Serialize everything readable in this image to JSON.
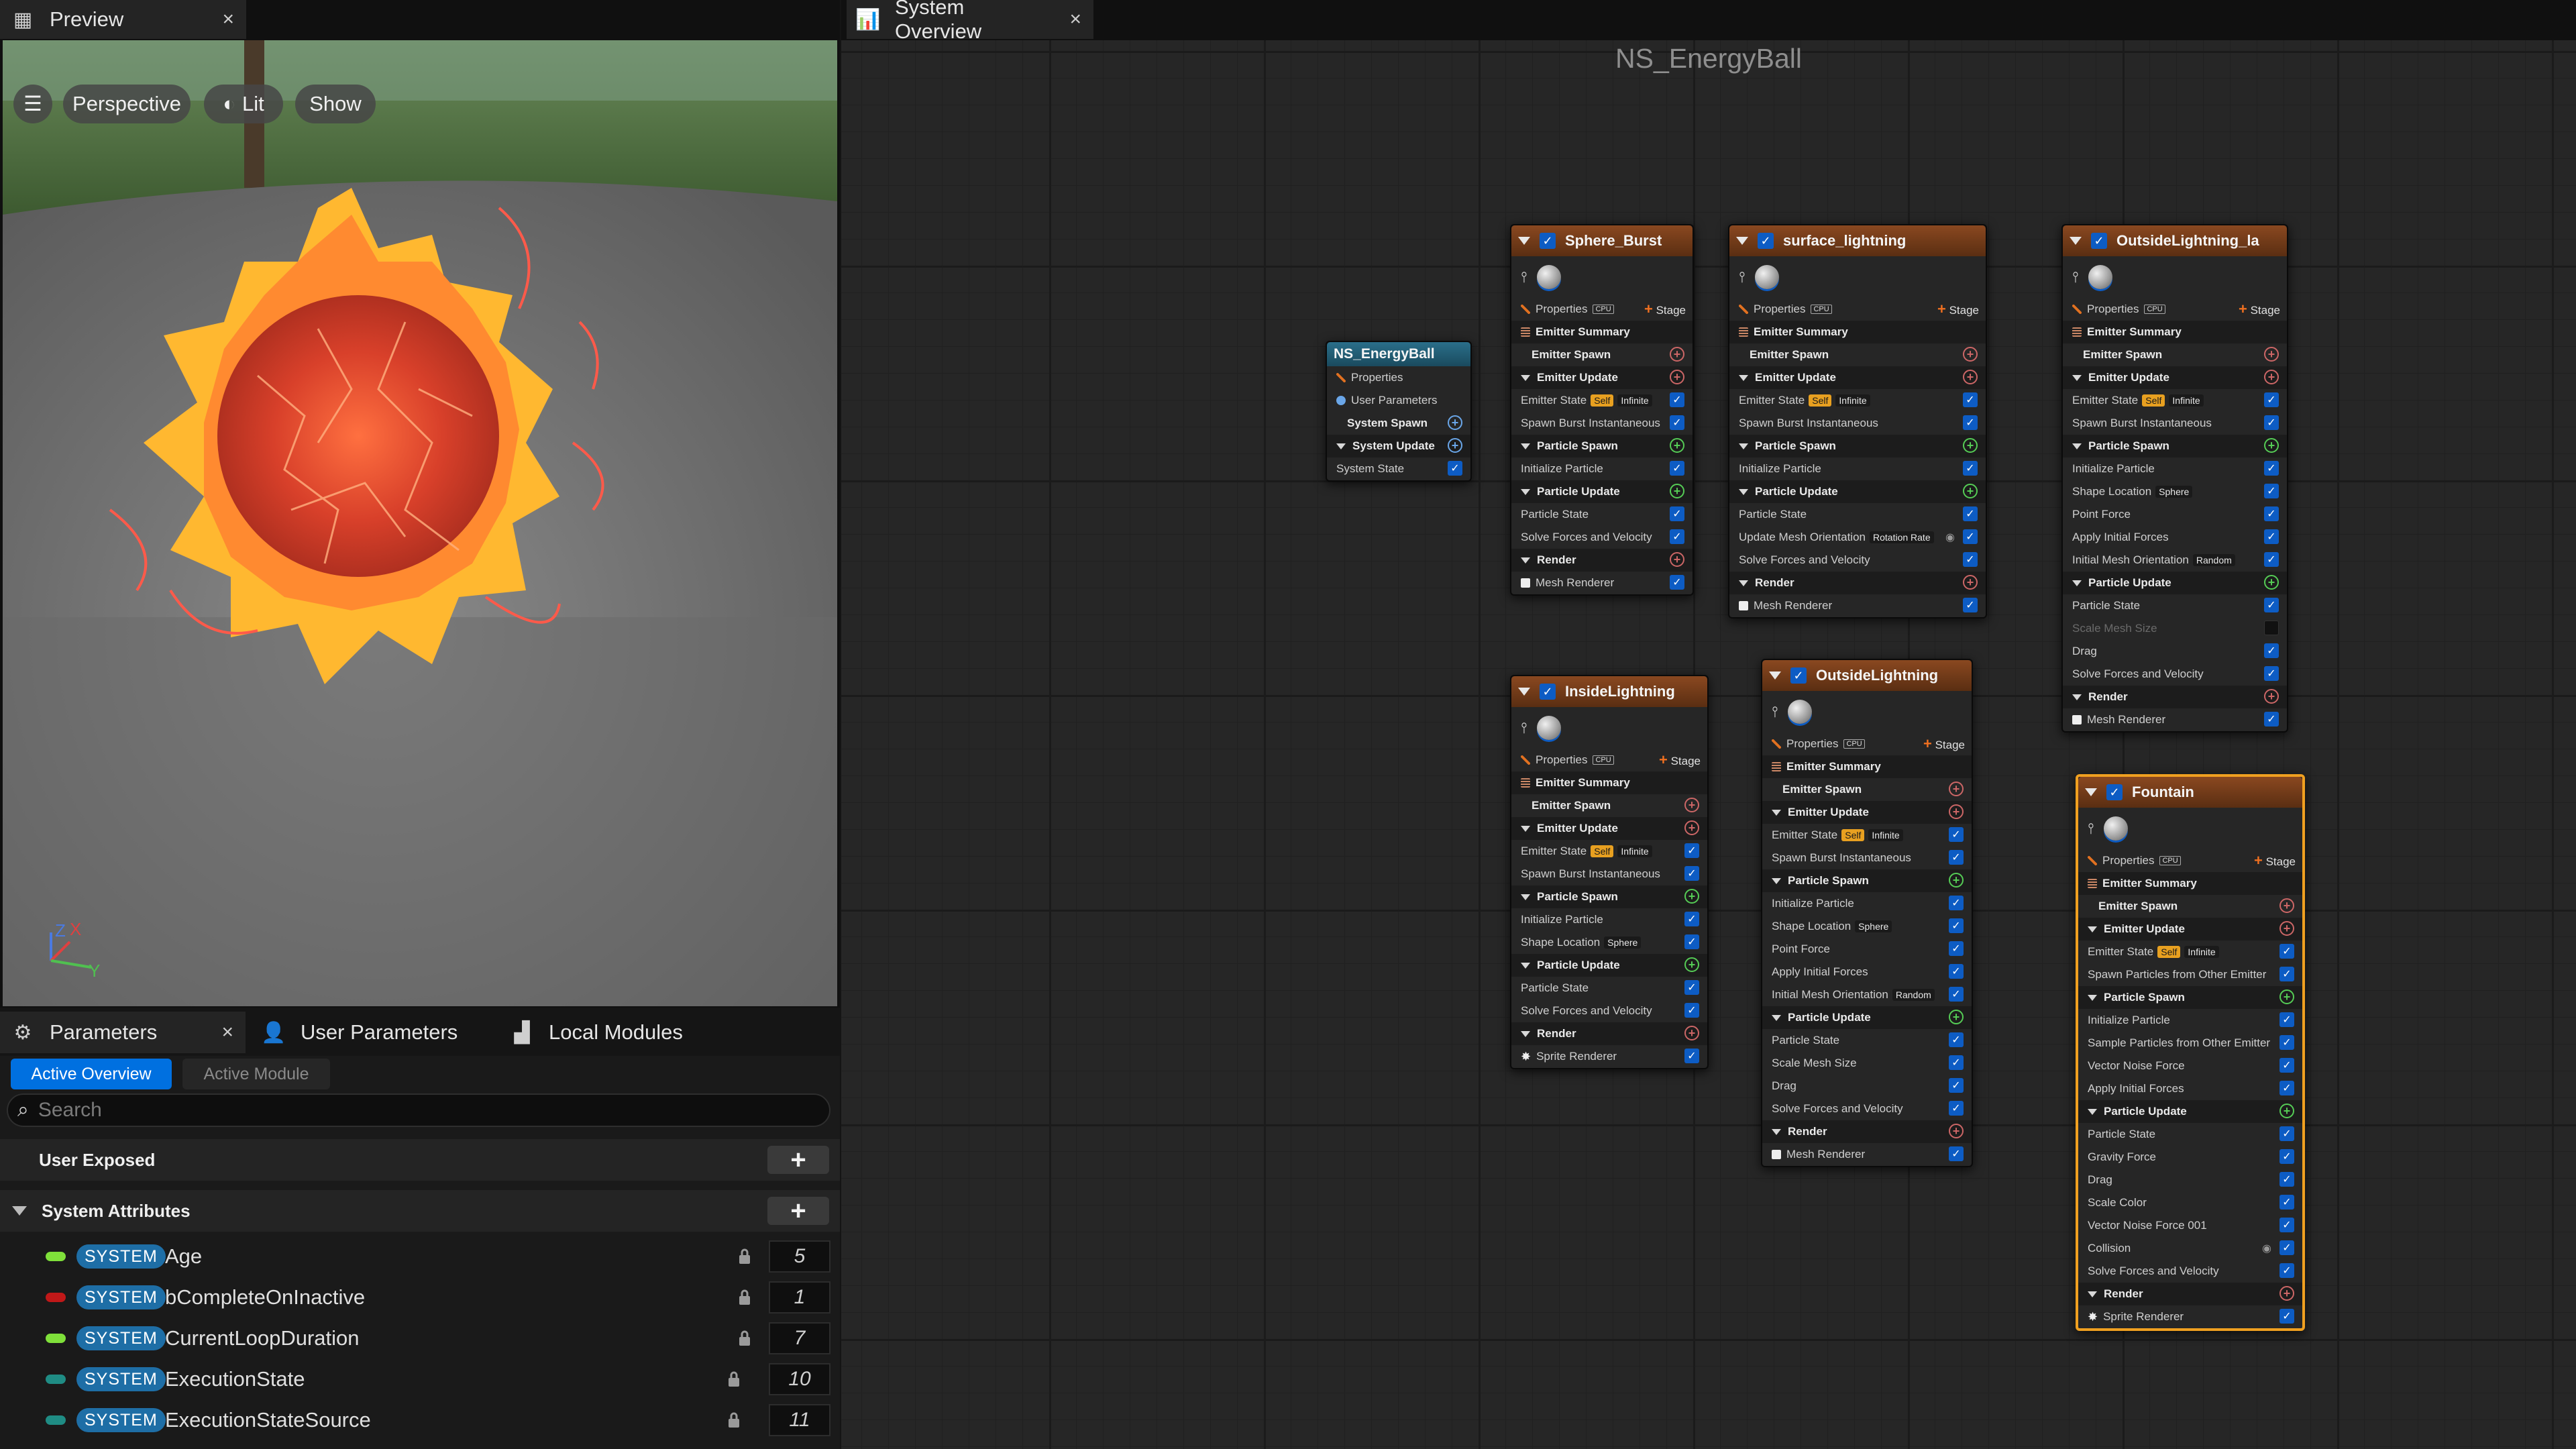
{
  "preview_tab": {
    "title": "Preview",
    "close": "×"
  },
  "viewport": {
    "perspective": "Perspective",
    "lit": "Lit",
    "show": "Show",
    "axis_z": "Z",
    "axis_x": "X",
    "axis_y": "Y"
  },
  "params_tabs": {
    "parameters": "Parameters",
    "close": "×",
    "user_parameters": "User Parameters",
    "local_modules": "Local Modules"
  },
  "params": {
    "active_overview": "Active Overview",
    "active_module": "Active Module",
    "search_placeholder": "Search",
    "user_exposed": "User Exposed",
    "system_attributes": "System Attributes",
    "add": "+",
    "attributes": [
      {
        "badge": "SYSTEM",
        "name": "Age",
        "value": "5",
        "color": "#7fe03a"
      },
      {
        "badge": "SYSTEM",
        "name": "bCompleteOnInactive",
        "value": "1",
        "color": "#c01818"
      },
      {
        "badge": "SYSTEM",
        "name": "CurrentLoopDuration",
        "value": "7",
        "color": "#7fe03a"
      },
      {
        "badge": "SYSTEM",
        "name": "ExecutionState",
        "value": "10",
        "color": "#1f8c84"
      },
      {
        "badge": "SYSTEM",
        "name": "ExecutionStateSource",
        "value": "11",
        "color": "#1f8c84"
      }
    ]
  },
  "graph_tab": {
    "title": "System Overview",
    "close": "×"
  },
  "graph_title": "NS_EnergyBall",
  "system_node": {
    "title": "NS_EnergyBall",
    "properties": "Properties",
    "user_parameters": "User Parameters",
    "system_spawn": "System Spawn",
    "system_update": "System Update",
    "system_state": "System State"
  },
  "labels": {
    "properties": "Properties",
    "stage": "Stage",
    "plus": "+",
    "check": "✓",
    "emitter_summary": "Emitter Summary",
    "emitter_spawn": "Emitter Spawn",
    "emitter_update": "Emitter Update",
    "emitter_state": "Emitter State",
    "self": "Self",
    "infinite": "Infinite",
    "particle_spawn": "Particle Spawn",
    "particle_update": "Particle Update",
    "render": "Render",
    "cpu": "CPU",
    "sphere": "Sphere",
    "random": "Random",
    "rotation_rate": "Rotation Rate"
  },
  "emitters": [
    {
      "name": "Sphere_Burst",
      "modules_spawn": [
        "Initialize Particle"
      ],
      "modules_update": [
        "Particle State",
        "Solve Forces and Velocity"
      ],
      "emitter_update": [
        "Spawn Burst Instantaneous"
      ],
      "renderer": "Mesh Renderer"
    },
    {
      "name": "surface_lightning",
      "modules_spawn": [
        "Initialize Particle"
      ],
      "modules_update": [
        "Particle State",
        "Update Mesh Orientation",
        "Solve Forces and Velocity"
      ],
      "emitter_update": [
        "Spawn Burst Instantaneous"
      ],
      "renderer": "Mesh Renderer"
    },
    {
      "name": "OutsideLightning_la",
      "modules_spawn": [
        "Initialize Particle",
        "Shape Location",
        "Point Force",
        "Apply Initial Forces",
        "Initial Mesh Orientation"
      ],
      "modules_update": [
        "Particle State",
        "Scale Mesh Size",
        "Drag",
        "Solve Forces and Velocity"
      ],
      "emitter_update": [
        "Spawn Burst Instantaneous"
      ],
      "renderer": "Mesh Renderer"
    },
    {
      "name": "InsideLightning",
      "modules_spawn": [
        "Initialize Particle",
        "Shape Location"
      ],
      "modules_update": [
        "Particle State",
        "Solve Forces and Velocity"
      ],
      "emitter_update": [
        "Spawn Burst Instantaneous"
      ],
      "renderer": "Sprite Renderer"
    },
    {
      "name": "OutsideLightning",
      "modules_spawn": [
        "Initialize Particle",
        "Shape Location",
        "Point Force",
        "Apply Initial Forces",
        "Initial Mesh Orientation"
      ],
      "modules_update": [
        "Particle State",
        "Scale Mesh Size",
        "Drag",
        "Solve Forces and Velocity"
      ],
      "emitter_update": [
        "Spawn Burst Instantaneous"
      ],
      "renderer": "Mesh Renderer"
    },
    {
      "name": "Fountain",
      "modules_spawn": [
        "Initialize Particle",
        "Sample Particles from Other Emitter",
        "Vector Noise Force",
        "Apply Initial Forces"
      ],
      "modules_update": [
        "Particle State",
        "Gravity Force",
        "Drag",
        "Scale Color",
        "Vector Noise Force 001",
        "Collision",
        "Solve Forces and Velocity"
      ],
      "emitter_update": [
        "Spawn Particles from Other Emitter"
      ],
      "renderer": "Sprite Renderer"
    }
  ]
}
